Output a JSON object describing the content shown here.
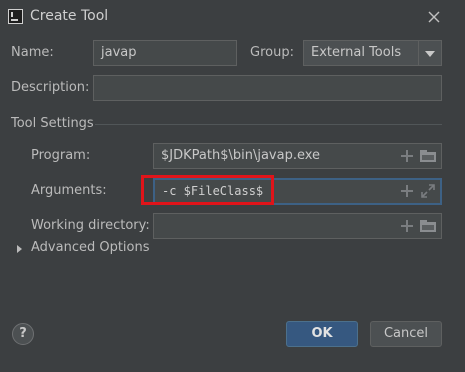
{
  "window": {
    "title": "Create Tool",
    "icons": {
      "app": "intellij-app-icon",
      "close": "close-icon"
    }
  },
  "form": {
    "name_label": "Name:",
    "name_value": "javap",
    "group_label": "Group:",
    "group_value": "External Tools",
    "description_label": "Description:",
    "description_value": ""
  },
  "tool_settings": {
    "section_label": "Tool Settings",
    "program_label": "Program:",
    "program_value": "$JDKPath$\\bin\\javap.exe",
    "arguments_label": "Arguments:",
    "arguments_value": "-c $FileClass$",
    "working_dir_label": "Working directory:",
    "working_dir_value": ""
  },
  "advanced": {
    "label": "Advanced Options",
    "expanded": false
  },
  "footer": {
    "help_label": "?",
    "ok_label": "OK",
    "cancel_label": "Cancel"
  },
  "colors": {
    "background": "#3c3f41",
    "field": "#45494a",
    "focus_border": "#3d6185",
    "primary_button": "#365880",
    "highlight_box": "#e0141a"
  }
}
